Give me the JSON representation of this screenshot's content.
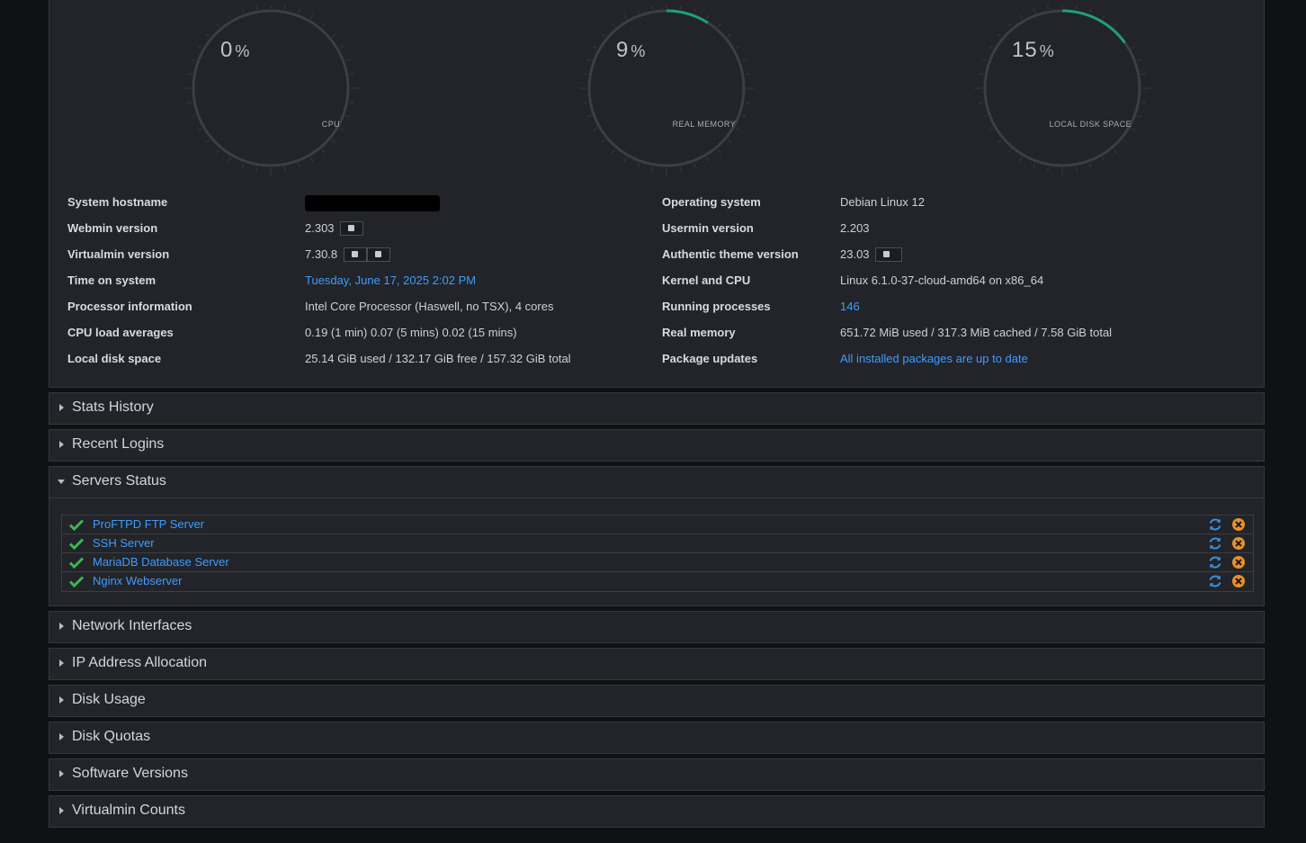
{
  "gauges": [
    {
      "value": "0",
      "unit": "%",
      "label": "CPU",
      "fraction": 0.0
    },
    {
      "value": "9",
      "unit": "%",
      "label": "REAL MEMORY",
      "fraction": 0.09
    },
    {
      "value": "15",
      "unit": "%",
      "label": "LOCAL DISK SPACE",
      "fraction": 0.15
    }
  ],
  "info_left": [
    {
      "label": "System hostname",
      "value": ""
    },
    {
      "label": "Webmin version",
      "value": "2.303"
    },
    {
      "label": "Virtualmin version",
      "value": "7.30.8"
    },
    {
      "label": "Time on system",
      "value": "Tuesday, June 17, 2025 2:02 PM"
    },
    {
      "label": "Processor information",
      "value": "Intel Core Processor (Haswell, no TSX), 4 cores"
    },
    {
      "label": "CPU load averages",
      "value": "0.19 (1 min) 0.07 (5 mins) 0.02 (15 mins)"
    },
    {
      "label": "Local disk space",
      "value": "25.14 GiB used / 132.17 GiB free / 157.32 GiB total"
    }
  ],
  "info_right": [
    {
      "label": "Operating system",
      "value": "Debian Linux 12"
    },
    {
      "label": "Usermin version",
      "value": "2.203"
    },
    {
      "label": "Authentic theme version",
      "value": "23.03"
    },
    {
      "label": "Kernel and CPU",
      "value": "Linux 6.1.0-37-cloud-amd64 on x86_64"
    },
    {
      "label": "Running processes",
      "value": "146"
    },
    {
      "label": "Real memory",
      "value": "651.72 MiB used / 317.3 MiB cached / 7.58 GiB total"
    },
    {
      "label": "Package updates",
      "value": "All installed packages are up to date"
    }
  ],
  "sections": {
    "stats_history": "Stats History",
    "recent_logins": "Recent Logins",
    "servers_status": "Servers Status",
    "network_interfaces": "Network Interfaces",
    "ip_address_allocation": "IP Address Allocation",
    "disk_usage": "Disk Usage",
    "disk_quotas": "Disk Quotas",
    "software_versions": "Software Versions",
    "virtualmin_counts": "Virtualmin Counts"
  },
  "servers": [
    {
      "name": "ProFTPD FTP Server",
      "status": "running"
    },
    {
      "name": "SSH Server",
      "status": "running"
    },
    {
      "name": "MariaDB Database Server",
      "status": "running"
    },
    {
      "name": "Nginx Webserver",
      "status": "running"
    }
  ],
  "colors": {
    "accent": "#3f9bff",
    "gauge_arc": "#1f9e7a",
    "check": "#3cb552",
    "stop": "#e8902a",
    "restart": "#3d8fd6"
  }
}
